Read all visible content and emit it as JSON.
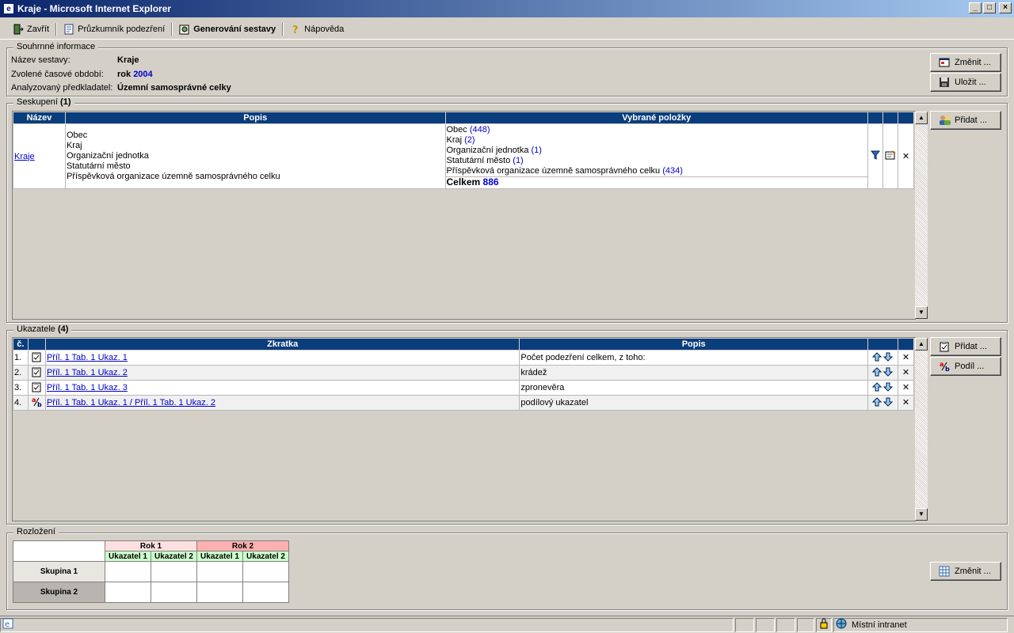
{
  "window": {
    "title": "Kraje - Microsoft Internet Explorer"
  },
  "toolbar": {
    "close": "Zavřít",
    "explorer": "Průzkumník podezření",
    "generate": "Generování sestavy",
    "help": "Nápověda"
  },
  "summary": {
    "legend": "Souhrnné informace",
    "name_label": "Název sestavy:",
    "name_value": "Kraje",
    "period_label": "Zvolené časové období:",
    "period_prefix": "rok",
    "period_value": "2004",
    "submitter_label": "Analyzovaný předkladatel:",
    "submitter_value": "Územní samosprávné celky",
    "change_btn": "Změnit ...",
    "save_btn": "Uložit ..."
  },
  "grouping": {
    "legend": "Seskupení",
    "count": "(1)",
    "headers": {
      "name": "Název",
      "desc": "Popis",
      "selected": "Vybrané položky"
    },
    "row": {
      "name": "Kraje",
      "desc": [
        "Obec",
        "Kraj",
        "Organizační jednotka",
        "Statutární město",
        "Příspěvková organizace územně samosprávného celku"
      ],
      "items": [
        {
          "label": "Obec",
          "count": "(448)"
        },
        {
          "label": "Kraj",
          "count": "(2)"
        },
        {
          "label": "Organizační jednotka",
          "count": "(1)"
        },
        {
          "label": "Statutární město",
          "count": "(1)"
        },
        {
          "label": "Příspěvková organizace územně samosprávného celku",
          "count": "(434)"
        }
      ],
      "total_label": "Celkem",
      "total_value": "886"
    },
    "add_btn": "Přidat ..."
  },
  "indicators": {
    "legend": "Ukazatele",
    "count": "(4)",
    "headers": {
      "num": "č.",
      "abbr": "Zkratka",
      "desc": "Popis"
    },
    "rows": [
      {
        "num": "1.",
        "abbr": "Příl. 1 Tab. 1 Ukaz. 1",
        "desc": "Počet podezření celkem, z toho:",
        "icon": "clipboard-icon"
      },
      {
        "num": "2.",
        "abbr": "Příl. 1 Tab. 1 Ukaz. 2",
        "desc": "krádež",
        "icon": "clipboard-icon"
      },
      {
        "num": "3.",
        "abbr": "Příl. 1 Tab. 1 Ukaz. 3",
        "desc": "zpronevěra",
        "icon": "clipboard-icon"
      },
      {
        "num": "4.",
        "abbr": "Příl. 1 Tab. 1 Ukaz. 1 / Příl. 1 Tab. 1 Ukaz. 2",
        "desc": "podílový ukazatel",
        "icon": "ratio-icon"
      }
    ],
    "add_btn": "Přidat ...",
    "ratio_btn": "Podíl ..."
  },
  "layout": {
    "legend": "Rozložení",
    "year1": "Rok 1",
    "year2": "Rok 2",
    "ind1": "Ukazatel 1",
    "ind2": "Ukazatel 2",
    "group1": "Skupina 1",
    "group2": "Skupina 2",
    "change_btn": "Změnit ..."
  },
  "statusbar": {
    "zone": "Místní intranet"
  },
  "colors": {
    "header": "#0a3d7c",
    "year1": "#ffe0e0",
    "year2": "#ffb0b0",
    "indicator": "#ccffcc",
    "group1": "#e8e6e0",
    "group2": "#b8b4b0"
  }
}
